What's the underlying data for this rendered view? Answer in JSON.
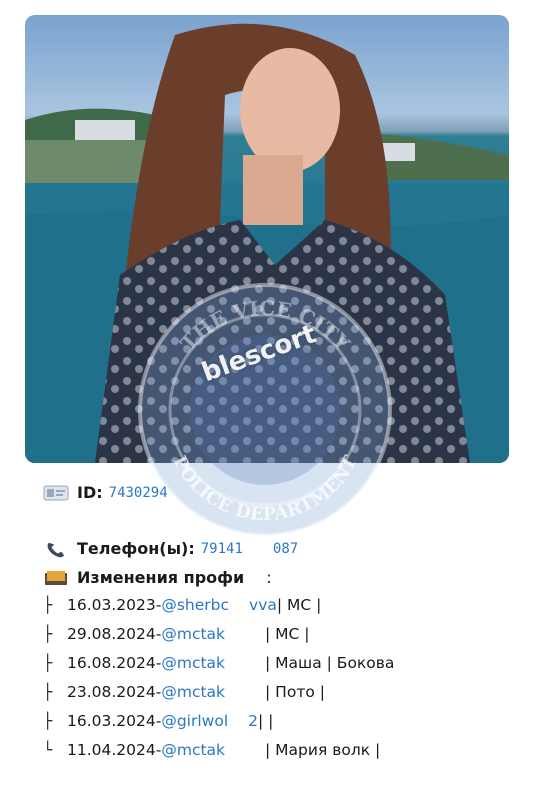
{
  "photo": {
    "alt_icon": "portrait-photo"
  },
  "watermark": {
    "text": "blescort",
    "seal_top": "THE VICE CITY",
    "seal_bottom": "POLICE DEPARTMENT"
  },
  "profile": {
    "id_label": "ID:",
    "id_value": "7430294",
    "phone_label": "Телефон(ы):",
    "phone_value_start": "79141",
    "phone_value_end": "087",
    "changes_label": "Изменения профи",
    "changes_colon": ":"
  },
  "history": [
    {
      "branch": "├",
      "date": "16.03.2023",
      "sep": " - ",
      "user": "@sherbc",
      "user_tail": "vva",
      "rest": " | МС |"
    },
    {
      "branch": "├",
      "date": "29.08.2024",
      "sep": " - ",
      "user": "@mctak",
      "user_tail": "",
      "rest": " | МС |"
    },
    {
      "branch": "├",
      "date": "16.08.2024",
      "sep": " - ",
      "user": "@mctak",
      "user_tail": "",
      "rest": " | Маша | Бокова"
    },
    {
      "branch": "├",
      "date": "23.08.2024",
      "sep": " - ",
      "user": "@mctak",
      "user_tail": "",
      "rest": " | Пото |"
    },
    {
      "branch": "├",
      "date": "16.03.2024",
      "sep": " - ",
      "user": "@girlwol",
      "user_tail": "2",
      "rest": " |  |"
    },
    {
      "branch": "└",
      "date": "11.04.2024",
      "sep": " - ",
      "user": "@mctak",
      "user_tail": "",
      "rest": " | Мария волк |"
    }
  ],
  "icons": {
    "id": "id-card-icon",
    "phone": "telephone-icon",
    "changes": "card-file-icon"
  },
  "colors": {
    "link": "#2a77c4",
    "text": "#1a1a1a"
  }
}
